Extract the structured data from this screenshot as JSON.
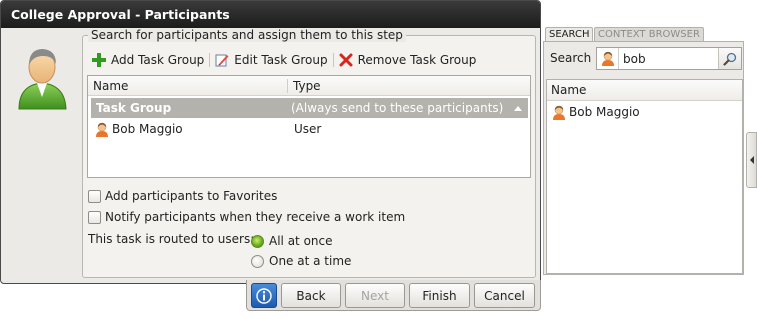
{
  "dialog": {
    "title": "College Approval - Participants"
  },
  "participants": {
    "legend": "Search for participants and assign them to this step",
    "toolbar": {
      "add_label": "Add Task Group",
      "edit_label": "Edit Task Group",
      "remove_label": "Remove Task Group"
    },
    "grid": {
      "columns": [
        "Name",
        "Type"
      ],
      "group_row": {
        "name": "Task Group",
        "type": "(Always send to these participants)"
      },
      "rows": [
        {
          "name": "Bob Maggio",
          "type": "User"
        }
      ]
    },
    "favorites_label": "Add participants to Favorites",
    "notify_label": "Notify participants when they receive a work item",
    "routed_label": "This task is routed to users:",
    "routing_options": [
      {
        "label": "All at once",
        "selected": true
      },
      {
        "label": "One at a time",
        "selected": false
      }
    ]
  },
  "footer": {
    "back_label": "Back",
    "next_label": "Next",
    "finish_label": "Finish",
    "cancel_label": "Cancel"
  },
  "side_panel": {
    "tabs": [
      "SEARCH",
      "CONTEXT BROWSER"
    ],
    "search_label": "Search",
    "search_value": "bob",
    "results_header": "Name",
    "results": [
      "Bob Maggio"
    ]
  },
  "colors": {
    "title_bar": "#1c1c1c",
    "group_row": "#b4b2ac",
    "info_button": "#1d5ab0",
    "radio_selected": "#6aa620"
  }
}
